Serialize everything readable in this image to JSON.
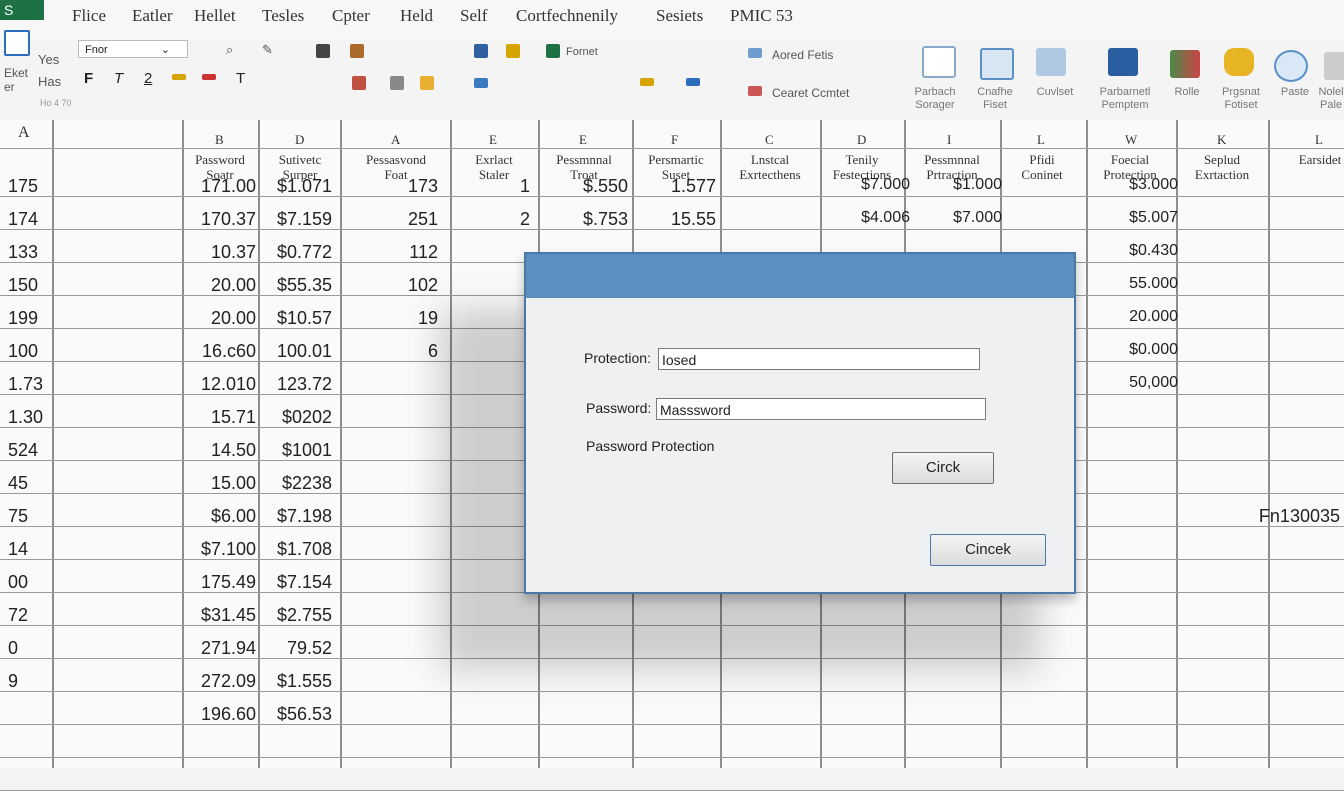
{
  "app": {
    "badge": "S"
  },
  "menu": [
    "Flice",
    "Eatler",
    "Hellet",
    "Tesles",
    "Cpter",
    "Held",
    "Self",
    "Cortfechnenily",
    "Sesiets",
    "PMIC 53"
  ],
  "ribbon": {
    "paste_label": "Yes",
    "paste_label2": "Has",
    "side_label": "Eket",
    "side_label2": "er",
    "font_name": "Fnor",
    "format_label": "Fornet",
    "sort_label": "Aored Fetis",
    "cond_label": "Cearet Ccmtet",
    "small": "Ho 4 70",
    "groups": [
      {
        "l1": "Parbach",
        "l2": "Sorager",
        "icon": "document-check-icon"
      },
      {
        "l1": "Cnafhe",
        "l2": "Fiset",
        "icon": "monitor-icon"
      },
      {
        "l1": "Cuvlset",
        "l2": "",
        "icon": "people-icon"
      },
      {
        "l1": "Parbarnetl",
        "l2": "Pemptem",
        "icon": "chart-icon"
      },
      {
        "l1": "Rolle",
        "l2": "",
        "icon": "bars-icon"
      },
      {
        "l1": "Prgsnat",
        "l2": "Fotiset",
        "icon": "lock-icon"
      },
      {
        "l1": "Paste",
        "l2": "",
        "icon": "globe-icon"
      },
      {
        "l1": "Nolel",
        "l2": "Pale",
        "icon": "grid-icon"
      }
    ]
  },
  "columns": {
    "row_head": "A",
    "letters": [
      "B",
      "D",
      "A",
      "E",
      "E",
      "F",
      "C",
      "D",
      "I",
      "L",
      "W",
      "K",
      "L"
    ],
    "headers": [
      "Password\nSoatr",
      "Sutivetc\nSurper",
      "Pessasvond\nFoat",
      "Exrlact\nStaler",
      "Pessmnnal\nTroat",
      "Persmartic\nSuset",
      "Lnstcal\nExrtecthens",
      "Tenily\nFestections",
      "Pessmnnal\nPrtraction",
      "Pfidi\nConinet",
      "Foecial\nProtection",
      "Seplud\nExrtaction",
      "Earsidet"
    ]
  },
  "rows": [
    {
      "a": "175",
      "b": "171.00",
      "c": "$1.071",
      "d": "173",
      "e": "1",
      "f": "$.550",
      "g": "1.577",
      "h": "$7.000",
      "i": "$1.000",
      "j": "$3.000"
    },
    {
      "a": "174",
      "b": "170.37",
      "c": "$7.159",
      "d": "251",
      "e": "2",
      "f": "$.753",
      "g": "15.55",
      "h": "$4.006",
      "i": "$7.000",
      "j": "$5.007"
    },
    {
      "a": "133",
      "b": "10.37",
      "c": "$0.772",
      "d": "112",
      "j": "$0.430"
    },
    {
      "a": "150",
      "b": "20.00",
      "c": "$55.35",
      "d": "102",
      "j": "55.000"
    },
    {
      "a": "199",
      "b": "20.00",
      "c": "$10.57",
      "d": "19",
      "j": "20.000"
    },
    {
      "a": "100",
      "b": "16.c60",
      "c": "100.01",
      "d": "6",
      "j": "$0.000"
    },
    {
      "a": "1.73",
      "b": "12.010",
      "c": "123.72",
      "j": "50,000"
    },
    {
      "a": "1.30",
      "b": "15.71",
      "c": "$0202"
    },
    {
      "a": "524",
      "b": "14.50",
      "c": "$1001"
    },
    {
      "a": "45",
      "b": "15.00",
      "c": "$2238"
    },
    {
      "a": "75",
      "b": "$6.00",
      "c": "$7.198",
      "k": "Fn130035"
    },
    {
      "a": "14",
      "b": "$7.100",
      "c": "$1.708"
    },
    {
      "a": "00",
      "b": "175.49",
      "c": "$7.154"
    },
    {
      "a": "72",
      "b": "$31.45",
      "c": "$2.755"
    },
    {
      "a": "0",
      "b": "271.94",
      "c": "79.52"
    },
    {
      "a": "9",
      "b": "272.09",
      "c": "$1.555"
    },
    {
      "a": "",
      "b": "196.60",
      "c": "$56.53"
    }
  ],
  "dialog": {
    "protection_label": "Protection:",
    "protection_value": "Iosed",
    "password_label": "Password:",
    "password_value": "Masssword",
    "caption": "Password Protection",
    "button1": "Circk",
    "button2": "Cincek"
  }
}
